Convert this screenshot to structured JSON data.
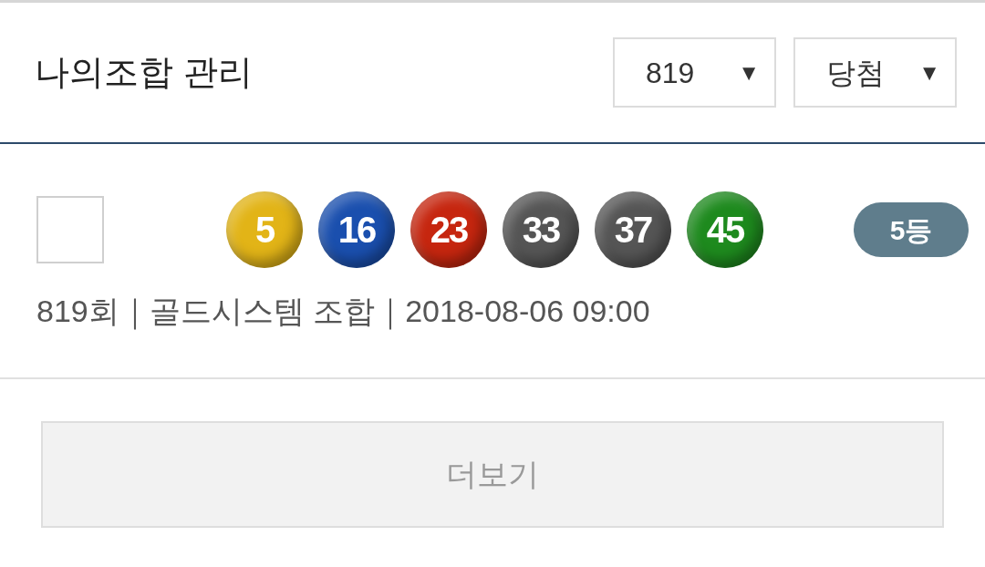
{
  "header": {
    "title": "나의조합 관리",
    "dropdowns": [
      {
        "value": "819",
        "arrow": "▼"
      },
      {
        "value": "당첨",
        "arrow": "▼"
      }
    ]
  },
  "combination": {
    "checked": false,
    "balls": [
      {
        "number": "5",
        "color": "#e2b417"
      },
      {
        "number": "16",
        "color": "#1a4fae"
      },
      {
        "number": "23",
        "color": "#c6260f"
      },
      {
        "number": "33",
        "color": "#555555"
      },
      {
        "number": "37",
        "color": "#555555"
      },
      {
        "number": "45",
        "color": "#1e8a1e"
      }
    ],
    "rank": "5등",
    "info": "819회｜골드시스템 조합｜2018-08-06 09:00"
  },
  "more_button": "더보기"
}
